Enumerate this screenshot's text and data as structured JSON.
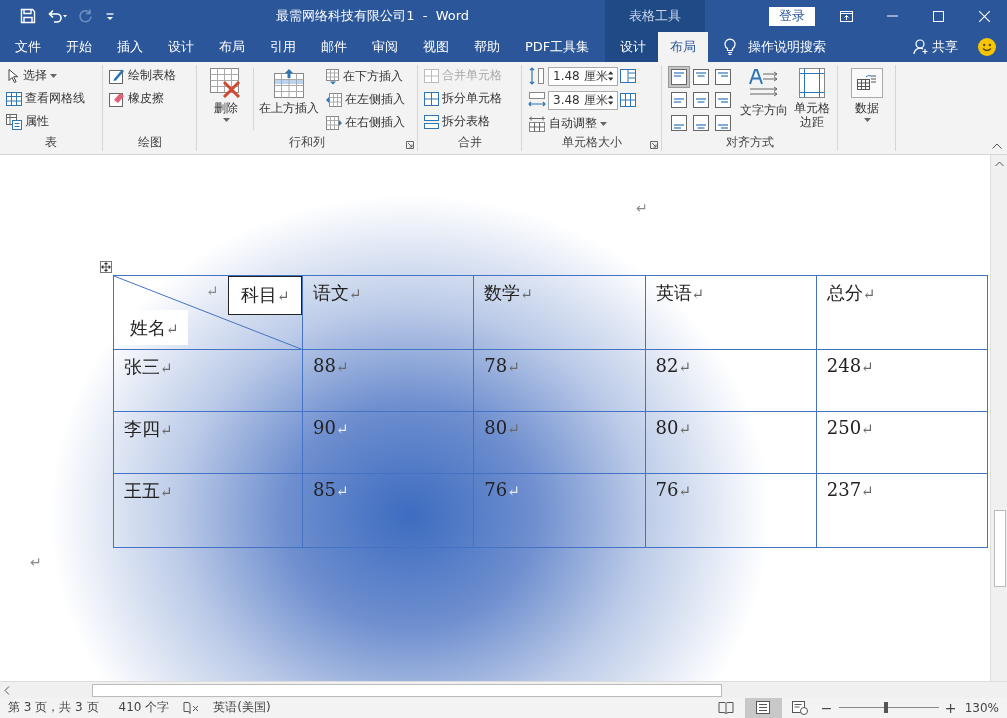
{
  "title_bar": {
    "title": "最需网络科技有限公司1  -  Word",
    "context_tab": "表格工具",
    "sign_in": "登录"
  },
  "menu_tabs": [
    {
      "label": "文件",
      "selected": false,
      "kind": "main"
    },
    {
      "label": "开始",
      "selected": false,
      "kind": "main"
    },
    {
      "label": "插入",
      "selected": false,
      "kind": "main"
    },
    {
      "label": "设计",
      "selected": false,
      "kind": "main"
    },
    {
      "label": "布局",
      "selected": false,
      "kind": "main"
    },
    {
      "label": "引用",
      "selected": false,
      "kind": "main"
    },
    {
      "label": "邮件",
      "selected": false,
      "kind": "main"
    },
    {
      "label": "审阅",
      "selected": false,
      "kind": "main"
    },
    {
      "label": "视图",
      "selected": false,
      "kind": "main"
    },
    {
      "label": "帮助",
      "selected": false,
      "kind": "main"
    },
    {
      "label": "PDF工具集",
      "selected": false,
      "kind": "main"
    },
    {
      "label": "设计",
      "selected": false,
      "kind": "context"
    },
    {
      "label": "布局",
      "selected": true,
      "kind": "context"
    }
  ],
  "tell_me": {
    "placeholder": "操作说明搜索"
  },
  "share": "共享",
  "ribbon": {
    "groups": [
      {
        "label": "表",
        "items": [
          {
            "label": "选择",
            "dropdown": true
          },
          {
            "label": "查看网格线"
          },
          {
            "label": "属性"
          }
        ]
      },
      {
        "label": "绘图",
        "items": [
          {
            "label": "绘制表格"
          },
          {
            "label": "橡皮擦"
          }
        ]
      },
      {
        "label": "行和列",
        "launcher": true,
        "items": [
          {
            "label": "删除",
            "dropdown": true
          },
          {
            "label": "在上方插入"
          },
          {
            "label": "在下方插入"
          },
          {
            "label": "在左侧插入"
          },
          {
            "label": "在右侧插入"
          }
        ]
      },
      {
        "label": "合并",
        "items": [
          {
            "label": "合并单元格",
            "disabled": true
          },
          {
            "label": "拆分单元格",
            "disabled": false
          },
          {
            "label": "拆分表格",
            "disabled": false
          }
        ]
      },
      {
        "label": "单元格大小",
        "launcher": true,
        "fields": [
          {
            "value": "1.48 厘米"
          },
          {
            "value": "3.48 厘米"
          }
        ],
        "items": [
          {
            "label": "自动调整",
            "dropdown": true
          }
        ]
      },
      {
        "label": "对齐方式",
        "align_buttons": [
          {
            "selected": true
          },
          {
            "selected": false
          },
          {
            "selected": false
          },
          {
            "selected": false
          },
          {
            "selected": false
          },
          {
            "selected": false
          },
          {
            "selected": false
          },
          {
            "selected": false
          },
          {
            "selected": false
          }
        ],
        "items": [
          {
            "label": "文字方向"
          },
          {
            "label": "单元格边距"
          }
        ]
      },
      {
        "items": [
          {
            "label": "数据",
            "dropdown": true
          }
        ]
      }
    ]
  },
  "document": {
    "top_mark": "↵",
    "bottom_mark": "↵",
    "table": {
      "columns": [
        {
          "kind": "diagonal",
          "column_label": "科目",
          "row_label": "姓名",
          "mark": "↵"
        },
        {
          "text": "语文",
          "mark": "↵"
        },
        {
          "text": "数学",
          "mark": "↵"
        },
        {
          "text": "英语",
          "mark": "↵"
        },
        {
          "text": "总分",
          "mark": "↵"
        }
      ],
      "rows": [
        [
          {
            "text": "张三",
            "mark": "↵"
          },
          {
            "text": "88",
            "mark": "↵"
          },
          {
            "text": "78",
            "mark": "↵"
          },
          {
            "text": "82",
            "mark": "↵"
          },
          {
            "text": "248",
            "mark": "↵"
          }
        ],
        [
          {
            "text": "李四",
            "mark": "↵"
          },
          {
            "text": "90",
            "mark": "↵"
          },
          {
            "text": "80",
            "mark": "↵"
          },
          {
            "text": "80",
            "mark": "↵"
          },
          {
            "text": "250",
            "mark": "↵"
          }
        ],
        [
          {
            "text": "王五",
            "mark": "↵"
          },
          {
            "text": "85",
            "mark": "↵"
          },
          {
            "text": "76",
            "mark": "↵"
          },
          {
            "text": "76",
            "mark": "↵"
          },
          {
            "text": "237",
            "mark": "↵"
          }
        ]
      ]
    }
  },
  "status_bar": {
    "page": "第 3 页，共 3 页",
    "words": "410 个字",
    "language": "英语(美国)",
    "zoom_out": "−",
    "zoom_in": "+",
    "zoom": "130%",
    "zoom_level": {
      "level": 0.47
    },
    "views": [
      {
        "selected": false
      },
      {
        "selected": true
      },
      {
        "selected": false
      }
    ]
  }
}
